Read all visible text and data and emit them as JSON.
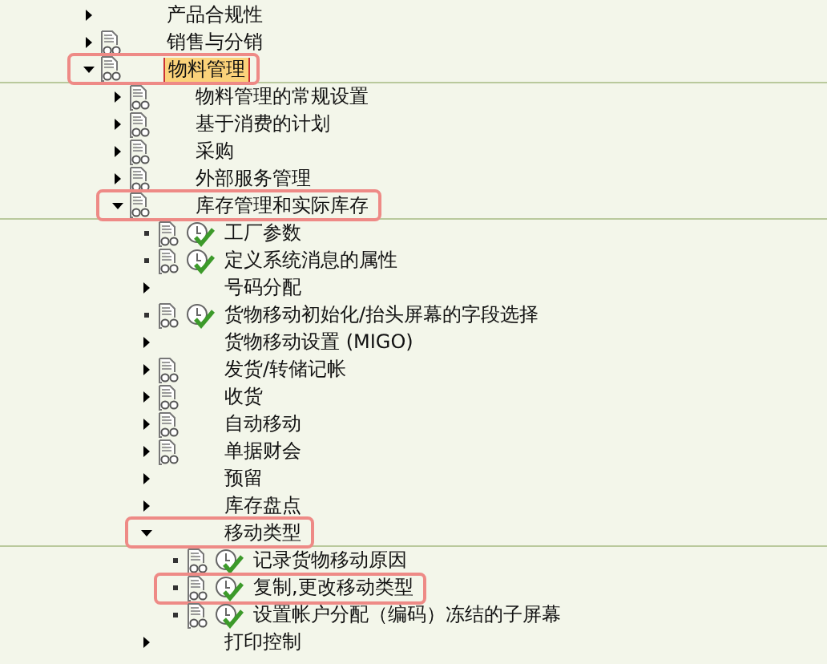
{
  "tree": [
    {
      "label": "产品合规性",
      "kind": "node",
      "expanded": false,
      "doc": false,
      "exec": false,
      "selected": false,
      "marked": false
    },
    {
      "label": "销售与分销",
      "kind": "node",
      "expanded": false,
      "doc": true,
      "exec": false,
      "selected": false,
      "marked": false
    },
    {
      "label": "物料管理",
      "kind": "node",
      "expanded": true,
      "doc": true,
      "exec": false,
      "selected": true,
      "marked": true,
      "children": [
        {
          "label": "物料管理的常规设置",
          "kind": "node",
          "expanded": false,
          "doc": true,
          "exec": false,
          "selected": false,
          "marked": false
        },
        {
          "label": "基于消费的计划",
          "kind": "node",
          "expanded": false,
          "doc": true,
          "exec": false,
          "selected": false,
          "marked": false
        },
        {
          "label": "采购",
          "kind": "node",
          "expanded": false,
          "doc": true,
          "exec": false,
          "selected": false,
          "marked": false
        },
        {
          "label": "外部服务管理",
          "kind": "node",
          "expanded": false,
          "doc": true,
          "exec": false,
          "selected": false,
          "marked": false
        },
        {
          "label": "库存管理和实际库存",
          "kind": "node",
          "expanded": true,
          "doc": true,
          "exec": false,
          "selected": false,
          "marked": true,
          "children": [
            {
              "label": "工厂参数",
              "kind": "leaf",
              "doc": true,
              "exec": true,
              "selected": false,
              "marked": false
            },
            {
              "label": "定义系统消息的属性",
              "kind": "leaf",
              "doc": true,
              "exec": true,
              "selected": false,
              "marked": false
            },
            {
              "label": "号码分配",
              "kind": "node",
              "expanded": false,
              "doc": false,
              "exec": false,
              "selected": false,
              "marked": false
            },
            {
              "label": "货物移动初始化/抬头屏幕的字段选择",
              "kind": "leaf",
              "doc": true,
              "exec": true,
              "selected": false,
              "marked": false
            },
            {
              "label": "货物移动设置 (MIGO)",
              "kind": "node",
              "expanded": false,
              "doc": false,
              "exec": false,
              "selected": false,
              "marked": false
            },
            {
              "label": "发货/转储记帐",
              "kind": "node",
              "expanded": false,
              "doc": true,
              "exec": false,
              "selected": false,
              "marked": false
            },
            {
              "label": "收货",
              "kind": "node",
              "expanded": false,
              "doc": true,
              "exec": false,
              "selected": false,
              "marked": false
            },
            {
              "label": "自动移动",
              "kind": "node",
              "expanded": false,
              "doc": true,
              "exec": false,
              "selected": false,
              "marked": false
            },
            {
              "label": "单据财会",
              "kind": "node",
              "expanded": false,
              "doc": true,
              "exec": false,
              "selected": false,
              "marked": false
            },
            {
              "label": "预留",
              "kind": "node",
              "expanded": false,
              "doc": false,
              "exec": false,
              "selected": false,
              "marked": false
            },
            {
              "label": "库存盘点",
              "kind": "node",
              "expanded": false,
              "doc": false,
              "exec": false,
              "selected": false,
              "marked": false
            },
            {
              "label": "移动类型",
              "kind": "node",
              "expanded": true,
              "doc": false,
              "exec": false,
              "selected": false,
              "marked": true,
              "children": [
                {
                  "label": "记录货物移动原因",
                  "kind": "leaf",
                  "doc": true,
                  "exec": true,
                  "selected": false,
                  "marked": false
                },
                {
                  "label": "复制,更改移动类型",
                  "kind": "leaf",
                  "doc": true,
                  "exec": true,
                  "selected": false,
                  "marked": true
                },
                {
                  "label": "设置帐户分配（编码）冻结的子屏幕",
                  "kind": "leaf",
                  "doc": true,
                  "exec": true,
                  "selected": false,
                  "marked": false
                }
              ]
            },
            {
              "label": "打印控制",
              "kind": "node",
              "expanded": false,
              "doc": false,
              "exec": false,
              "selected": false,
              "marked": false
            }
          ]
        }
      ]
    }
  ]
}
